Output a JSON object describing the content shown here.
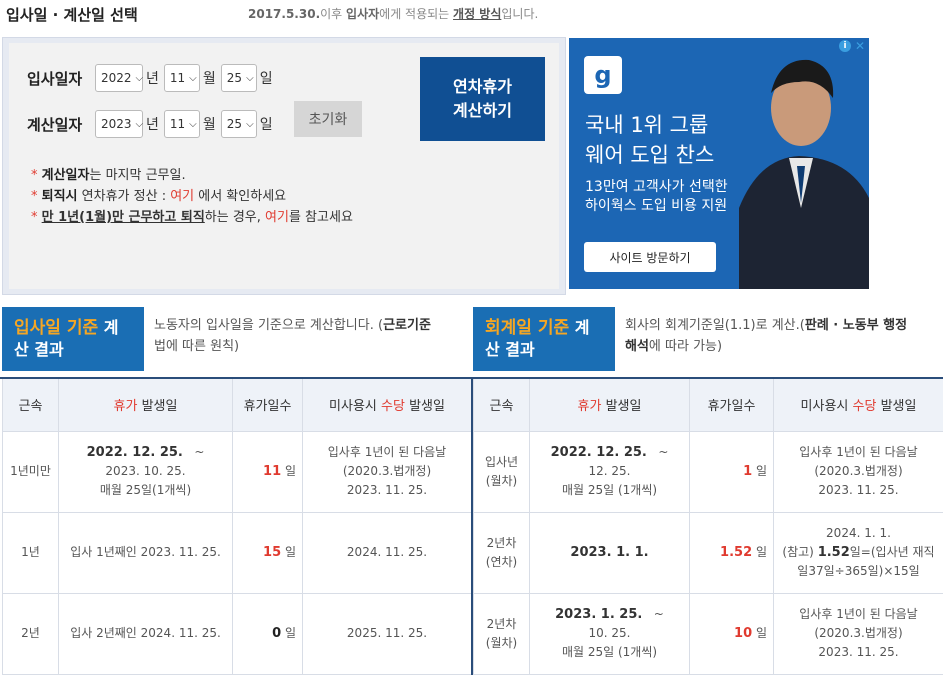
{
  "header": {
    "title": "입사일 · 계산일 선택",
    "notice_date": "2017.5.30.",
    "notice_mid1": "이후 ",
    "notice_bold": "입사자",
    "notice_mid2": "에게 적용되는 ",
    "notice_link": "개정 방식",
    "notice_end": "입니다."
  },
  "form": {
    "hire_label": "입사일자",
    "hire_year": "2022",
    "hire_month": "11",
    "hire_day": "25",
    "calc_label": "계산일자",
    "calc_year": "2023",
    "calc_month": "11",
    "calc_day": "25",
    "unit_year": "년",
    "unit_month": "월",
    "unit_day": "일",
    "reset_label": "초기화",
    "calc_button_line1": "연차휴가",
    "calc_button_line2": "계산하기",
    "note1_bold": "계산일자",
    "note1_rest": "는 마지막 근무일.",
    "note2_bold": "퇴직시",
    "note2_mid": " 연차휴가 정산 : ",
    "note2_link": "여기",
    "note2_end": " 에서 확인하세요",
    "note3_ul": "만 1년(1월)만 근무하고 퇴직",
    "note3_mid": "하는 경우, ",
    "note3_link": "여기",
    "note3_end": "를 참고세요"
  },
  "ad": {
    "logo_glyph": "g",
    "headline1": "국내 1위 그룹",
    "headline2": "웨어 도입 찬스",
    "sub1": "13만여 고객사가 선택한",
    "sub2": "하이웍스 도입 비용 지원",
    "visit": "사이트 방문하기",
    "info_glyph": "i",
    "close_glyph": "✕",
    "brand_color": "#1c66b4"
  },
  "result_left": {
    "badge_hl": "입사일 기준",
    "badge_rest1": " 계",
    "badge_rest2": "산 결과",
    "desc1": "노동자의 입사일을 기준으로 계산합니다. (",
    "desc_bold": "근로기준",
    "desc2": "법",
    "desc3": "에 따른 원칙)"
  },
  "result_right": {
    "badge_hl": "회계일 기준",
    "badge_rest1": " 계",
    "badge_rest2": "산 결과",
    "desc1": "회사의 회계기준일(1.1)로 계산.(",
    "desc_bold": "판례 · 노동부 행정",
    "desc_bold2": "해석",
    "desc3": "에 따라 가능)"
  },
  "table_headers": {
    "col1": "근속",
    "col2_red": "휴가",
    "col2_rest": " 발생일",
    "col3": "휴가일수",
    "col4_a": "미사용시 ",
    "col4_red": "수당",
    "col4_b": " 발생일"
  },
  "left_rows": [
    {
      "tenure": "1년미만",
      "d1": "2022. 12. 25.",
      "tilde": "~",
      "d2": "2023. 10. 25.",
      "d3": "매월 25일(1개씩)",
      "days": "11",
      "unit": "일",
      "p1": "입사후 1년이 된 다음날",
      "p2": "(2020.3.법개정)",
      "p3": "2023. 11. 25."
    },
    {
      "tenure": "1년",
      "date": "입사 1년째인 2023. 11. 25.",
      "days": "15",
      "unit": "일",
      "pay": "2024. 11. 25."
    },
    {
      "tenure": "2년",
      "date": "입사 2년째인 2024. 11. 25.",
      "days": "0",
      "unit": "일",
      "pay": "2025. 11. 25."
    }
  ],
  "right_rows": [
    {
      "t1": "입사년",
      "t2": "(월차)",
      "d1": "2022. 12. 25.",
      "tilde": "~",
      "d2": "12. 25.",
      "d3": "매월 25일 (1개씩)",
      "days": "1",
      "unit": "일",
      "p1": "입사후 1년이 된 다음날",
      "p2": "(2020.3.법개정)",
      "p3": "2023. 11. 25."
    },
    {
      "t1": "2년차",
      "t2": "(연차)",
      "date": "2023. 1. 1.",
      "days": "1.52",
      "unit": "일",
      "p1": "2024. 1. 1.",
      "p2a": "(참고) ",
      "p2b": "1.52",
      "p2c": "일=(입사년 재직",
      "p3": "일37일÷365일)×15일"
    },
    {
      "t1": "2년차",
      "t2": "(월차)",
      "d1": "2023. 1. 25.",
      "tilde": "~",
      "d2": "10. 25.",
      "d3": "매월 25일 (1개씩)",
      "days": "10",
      "unit": "일",
      "p1": "입사후 1년이 된 다음날",
      "p2": "(2020.3.법개정)",
      "p3": "2023. 11. 25."
    }
  ]
}
